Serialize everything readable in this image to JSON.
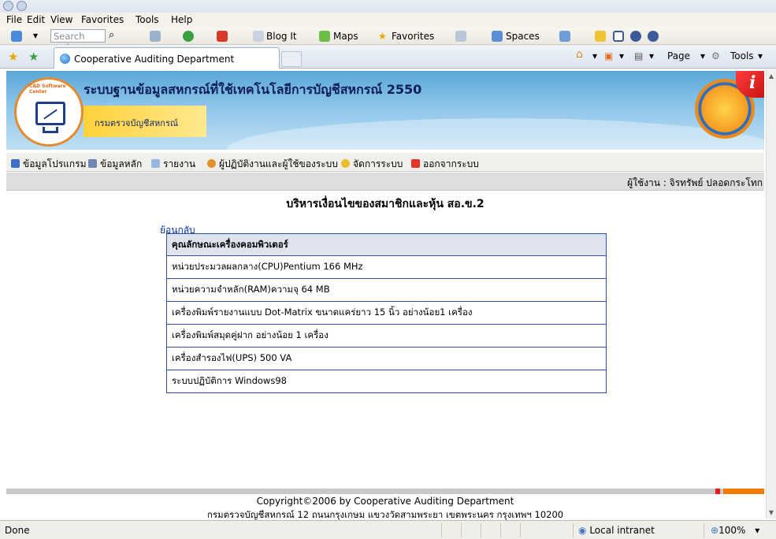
{
  "browser": {
    "menu": [
      "File",
      "Edit",
      "View",
      "Favorites",
      "Tools",
      "Help"
    ],
    "search_placeholder": "Search web",
    "toolbar_links": [
      "Blog It",
      "Maps",
      "Favorites",
      "Spaces"
    ],
    "tab_title": "Cooperative Auditing Department",
    "command_items": [
      "Page",
      "Tools"
    ]
  },
  "banner": {
    "logo_text": "CAD Software Center",
    "title": "ระบบฐานข้อมูลสหกรณ์ที่ใช้เทคโนโลยีการบัญชีสหกรณ์ 2550",
    "department": "กรมตรวจบัญชีสหกรณ์"
  },
  "nav": {
    "items": [
      "ข้อมูลโปรแกรม",
      "ข้อมูลหลัก",
      "รายงาน",
      "ผู้ปฏิบัติงานและผู้ใช้ของระบบ",
      "จัดการระบบ",
      "ออกจากระบบ"
    ]
  },
  "user": {
    "label": "ผู้ใช้งาน : จิรทรัพย์ ปลอดกระโทก"
  },
  "main": {
    "title": "บริหารเงื่อนไขของสมาชิกและหุ้น สอ.ข.2",
    "back_link": "ย้อนกลับ",
    "table_header": "คุณลักษณะเครื่องคอมพิวเตอร์",
    "rows": [
      "หน่วยประมวลผลกลาง(CPU)Pentium 166 MHz",
      "หน่วยความจำหลัก(RAM)ความจุ 64 MB",
      "เครื่องพิมพ์รายงานแบบ Dot-Matrix ขนาดแคร่ยาว 15 นิ้ว อย่างน้อย1 เครื่อง",
      "เครื่องพิมพ์สมุดคู่ฝาก อย่างน้อย 1 เครื่อง",
      "เครื่องสำรองไฟ(UPS) 500 VA",
      "ระบบปฏิบัติการ Windows98"
    ]
  },
  "footer": {
    "copyright": "Copyright©2006 by Cooperative Auditing Department",
    "address": "กรมตรวจบัญชีสหกรณ์ 12 ถนนกรุงเกษม แขวงวัดสามพระยา เขตพระนคร กรุงเทพฯ 10200"
  },
  "status": {
    "text": "Done",
    "zone": "Local intranet",
    "zoom": "100%"
  }
}
